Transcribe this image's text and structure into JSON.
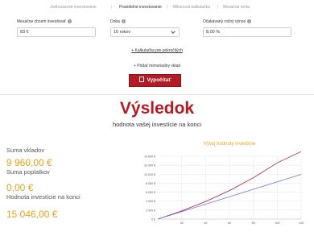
{
  "tabs": [
    {
      "label": "Jednorazové investovanie",
      "active": false
    },
    {
      "label": "Pravidelné investovanie",
      "active": true
    },
    {
      "label": "Milionová kalkulačka",
      "active": false
    },
    {
      "label": "Mesačná renta",
      "active": false
    }
  ],
  "form": {
    "monthly_label": "Mesačne chcem investovať",
    "monthly_value": "83 €",
    "duration_label": "Doba",
    "duration_value": "10 rokov",
    "yield_label": "Očakávaný ročný výnos",
    "yield_value": "8,00 %"
  },
  "links": {
    "calc_link": "+ Kalkulačka pre pokročilých",
    "add_deposit": "+ Pridať mimoriadny vklad"
  },
  "button": {
    "calculate_label": "Vypočítať"
  },
  "result": {
    "title": "Výsledok",
    "subtitle": "hodnota vašej investície na konci",
    "deposits_label": "Suma vkladov",
    "deposits_value": "9 960,00 €",
    "fees_label": "Suma poplatkov",
    "fees_value": "0,00 €",
    "final_label": "Hodnota investície na konci",
    "final_value": "15 046,00 €"
  },
  "colors": {
    "accent": "#b31b25",
    "value": "#e3a51a",
    "line_value": "#a31c3a",
    "line_deposits": "#6f74d9"
  },
  "chart_data": {
    "type": "line",
    "title": "Vývoj hodnoty investície",
    "xlim": [
      0,
      120
    ],
    "ylim": [
      0,
      14000
    ],
    "x_ticks": [
      "20",
      "40",
      "60",
      "80",
      "100",
      "120"
    ],
    "y_ticks": [
      "0 €",
      "2 000 €",
      "4 000 €",
      "6 000 €",
      "8 000 €",
      "10 000 €",
      "12 000 €",
      "14 000 €"
    ],
    "grid": true,
    "series": [
      {
        "color": "#a31c3a",
        "x": [
          0,
          20,
          40,
          60,
          80,
          100,
          120
        ],
        "values": [
          0,
          1805,
          3907,
          6352,
          9203,
          12522,
          15046
        ]
      },
      {
        "color": "#6f74d9",
        "x": [
          0,
          20,
          40,
          60,
          80,
          100,
          120
        ],
        "values": [
          0,
          1660,
          3320,
          4980,
          6640,
          8300,
          9960
        ]
      }
    ]
  }
}
